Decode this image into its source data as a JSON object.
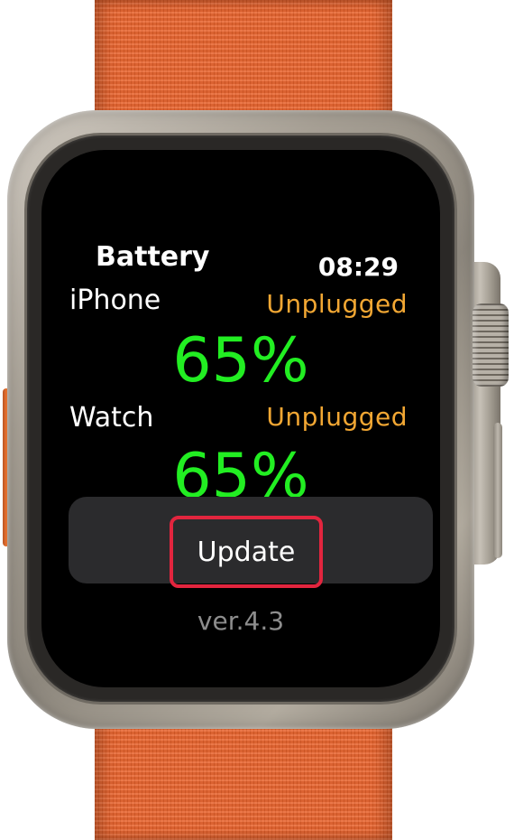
{
  "app": {
    "title": "Battery",
    "time": "08:29"
  },
  "iphone": {
    "label": "iPhone",
    "status": "Unplugged",
    "percent": "65%"
  },
  "watch": {
    "label": "Watch",
    "status": "Unplugged",
    "percent": "65%"
  },
  "actions": {
    "update_label": "Update"
  },
  "version": "ver.4.3",
  "colors": {
    "percent_green": "#22ee22",
    "status_orange": "#f2a733",
    "highlight_red": "#e2253e",
    "band_orange": "#e8612a",
    "version_gray": "#8d8d8d"
  }
}
